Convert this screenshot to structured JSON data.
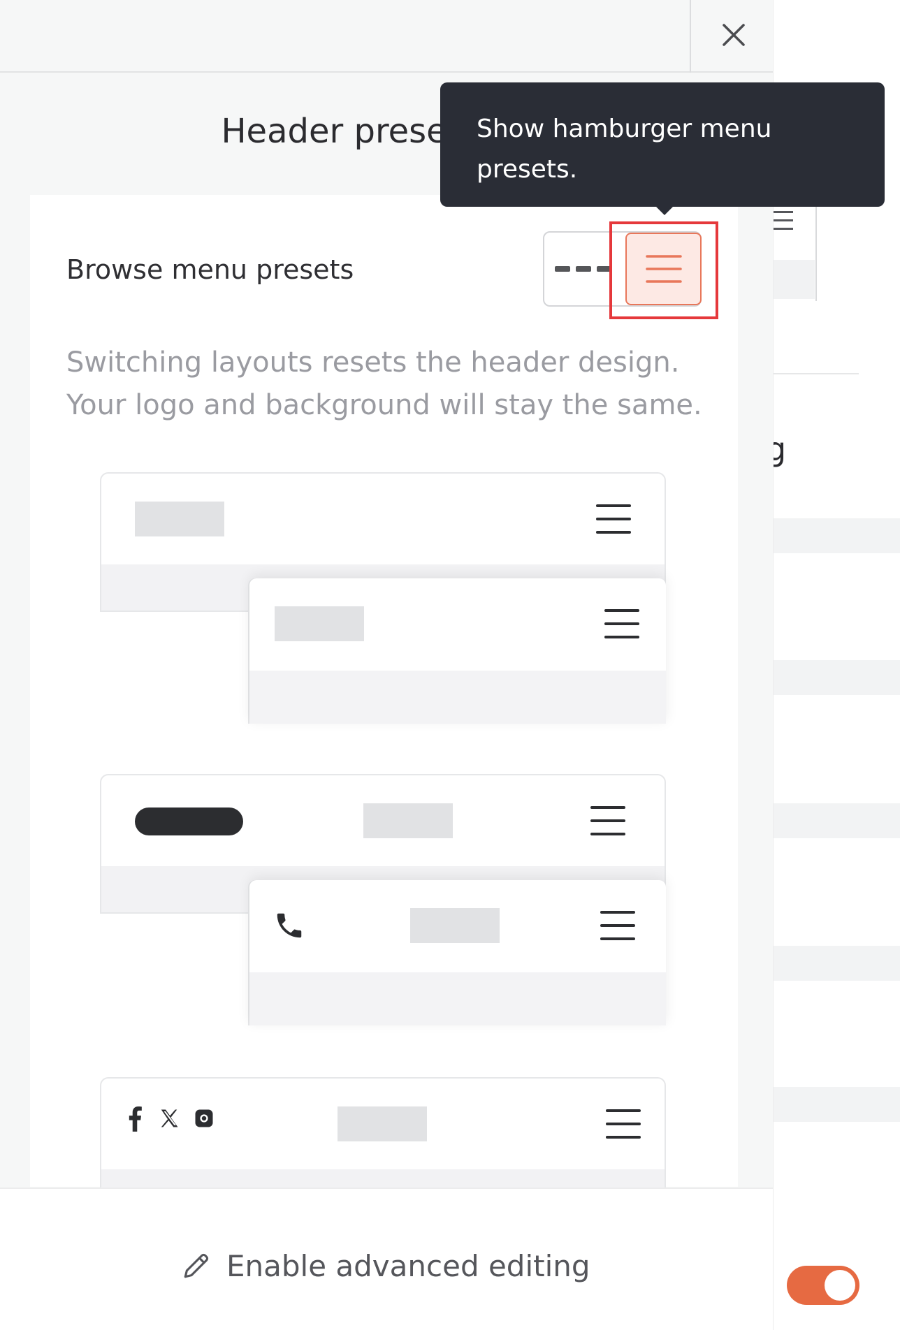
{
  "drawer": {
    "title": "Header presets",
    "close_icon": "close-icon"
  },
  "presets_panel": {
    "browse_label": "Browse menu presets",
    "layout_toggle": {
      "options": [
        "horizontal-menu-icon",
        "hamburger-menu-icon"
      ],
      "selected": "hamburger-menu-icon"
    },
    "description": "Switching layouts resets the header design. Your logo and background will stay the same."
  },
  "tooltip": {
    "text": "Show hamburger menu presets."
  },
  "footer": {
    "advanced_label": "Enable advanced editing",
    "icon": "pencil-icon"
  },
  "background": {
    "partial_text": "g",
    "toggle_on": true
  },
  "colors": {
    "accent": "#e66a42",
    "accent_light": "#fde9e4",
    "tooltip_bg": "#2a2d36",
    "highlight": "#e5383b"
  }
}
